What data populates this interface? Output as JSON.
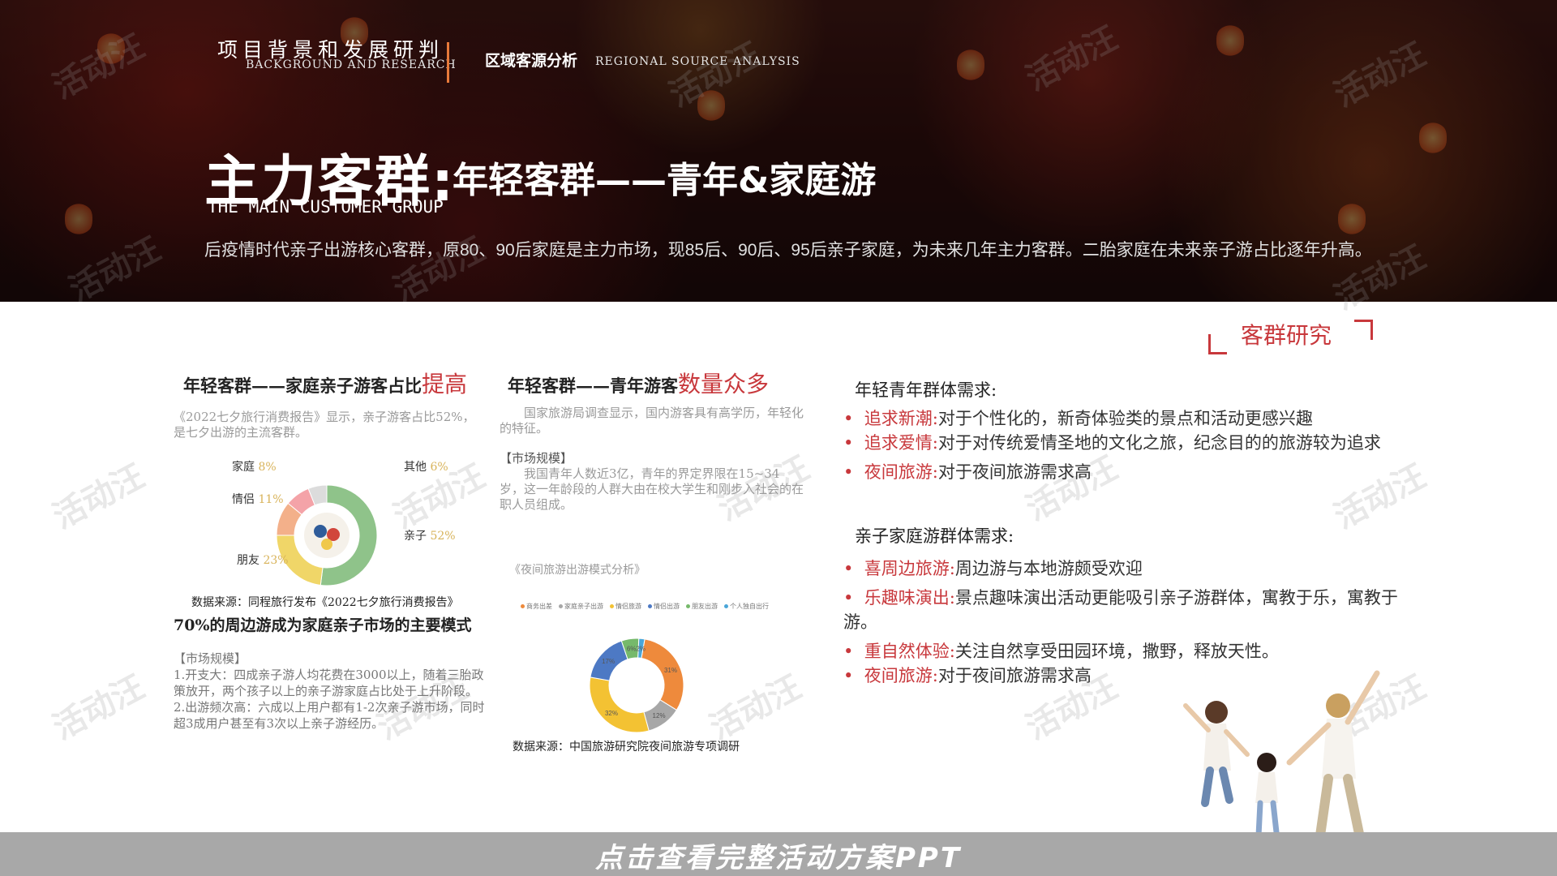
{
  "header": {
    "section_cn": "项目背景和发展研判",
    "section_en": "BACKGROUND AND RESEARCH",
    "subsection_cn": "区域客源分析",
    "subsection_en": "REGIONAL SOURCE ANALYSIS",
    "title_main": "主力客群:",
    "title_rest": "年轻客群——青年&家庭游",
    "title_en": "THE MAIN CUSTOMER GROUP",
    "intro": "后疫情时代亲子出游核心客群，原80、90后家庭是主力市场，现85后、90后、95后亲子家庭，为未来几年主力客群。二胎家庭在未来亲子游占比逐年升高。"
  },
  "tag": "客群研究",
  "col1": {
    "heading": "年轻客群——家庭亲子游客占比",
    "heading_hi": "提高",
    "desc": "《2022七夕旅行消费报告》显示，亲子游客占比52%，是七夕出游的主流客群。",
    "source": "数据来源：同程旅行发布《2022七夕旅行消费报告》",
    "heading2": "70%的周边游成为家庭亲子市场的主要模式",
    "market_title": "【市场规模】",
    "market_1": "1.开支大：四成亲子游人均花费在3000以上，随着三胎政策放开，两个孩子以上的亲子游家庭占比处于上升阶段。",
    "market_2": "2.出游频次高：六成以上用户都有1-2次亲子游市场，同时超3成用户甚至有3次以上亲子游经历。"
  },
  "col2": {
    "heading": "年轻客群——青年游客",
    "heading_hi": "数量众多",
    "desc": "国家旅游局调查显示，国内游客具有高学历，年轻化的特征。",
    "market_title": "【市场规模】",
    "market_text": "我国青年人数近3亿，青年的界定界限在15~34岁，这一年龄段的人群大由在校大学生和刚步入社会的在职人员组成。",
    "chart_title": "《夜间旅游出游模式分析》",
    "source": "数据来源：中国旅游研究院夜间旅游专项调研"
  },
  "col3": {
    "young_title": "年轻青年群体需求:",
    "young": [
      {
        "k": "追求新潮:",
        "v": "对于个性化的，新奇体验类的景点和活动更感兴趣"
      },
      {
        "k": "追求爱情:",
        "v": "对于对传统爱情圣地的文化之旅，纪念目的的旅游较为追求"
      },
      {
        "k": "夜间旅游:",
        "v": "对于夜间旅游需求高"
      }
    ],
    "family_title": "亲子家庭游群体需求:",
    "family": [
      {
        "k": "喜周边旅游:",
        "v": "周边游与本地游颇受欢迎"
      },
      {
        "k": "乐趣味演出:",
        "v": "景点趣味演出活动更能吸引亲子游群体，寓教于乐，寓教于游。"
      },
      {
        "k": "重自然体验:",
        "v": "关注自然享受田园环境，撒野，释放天性。"
      },
      {
        "k": "夜间旅游:",
        "v": "对于夜间旅游需求高"
      }
    ]
  },
  "watermark": "活动汪",
  "cta": "点击查看完整活动方案PPT",
  "chart_data": [
    {
      "type": "pie",
      "categories": [
        "亲子",
        "朋友",
        "情侣",
        "家庭",
        "其他"
      ],
      "values": [
        52,
        23,
        11,
        8,
        6
      ],
      "labels": [
        "52%",
        "23%",
        "11%",
        "8%",
        "6%"
      ],
      "colors": [
        "#8fc38a",
        "#f0d668",
        "#f3b08a",
        "#f4a3a8",
        "#dcdcdc"
      ]
    },
    {
      "type": "pie",
      "legend": [
        "商务出差",
        "家庭亲子出游",
        "情侣旅游",
        "情侣出游",
        "朋友出游",
        "个人独自出行"
      ],
      "values": [
        31,
        12,
        32,
        17,
        6,
        2
      ],
      "labels": [
        "31%",
        "12%",
        "32%",
        "17%",
        "6%",
        "2%"
      ],
      "colors": [
        "#ee8a3c",
        "#a7a7a7",
        "#f3c233",
        "#4d79c4",
        "#76b96b",
        "#4aa6d8"
      ]
    }
  ]
}
